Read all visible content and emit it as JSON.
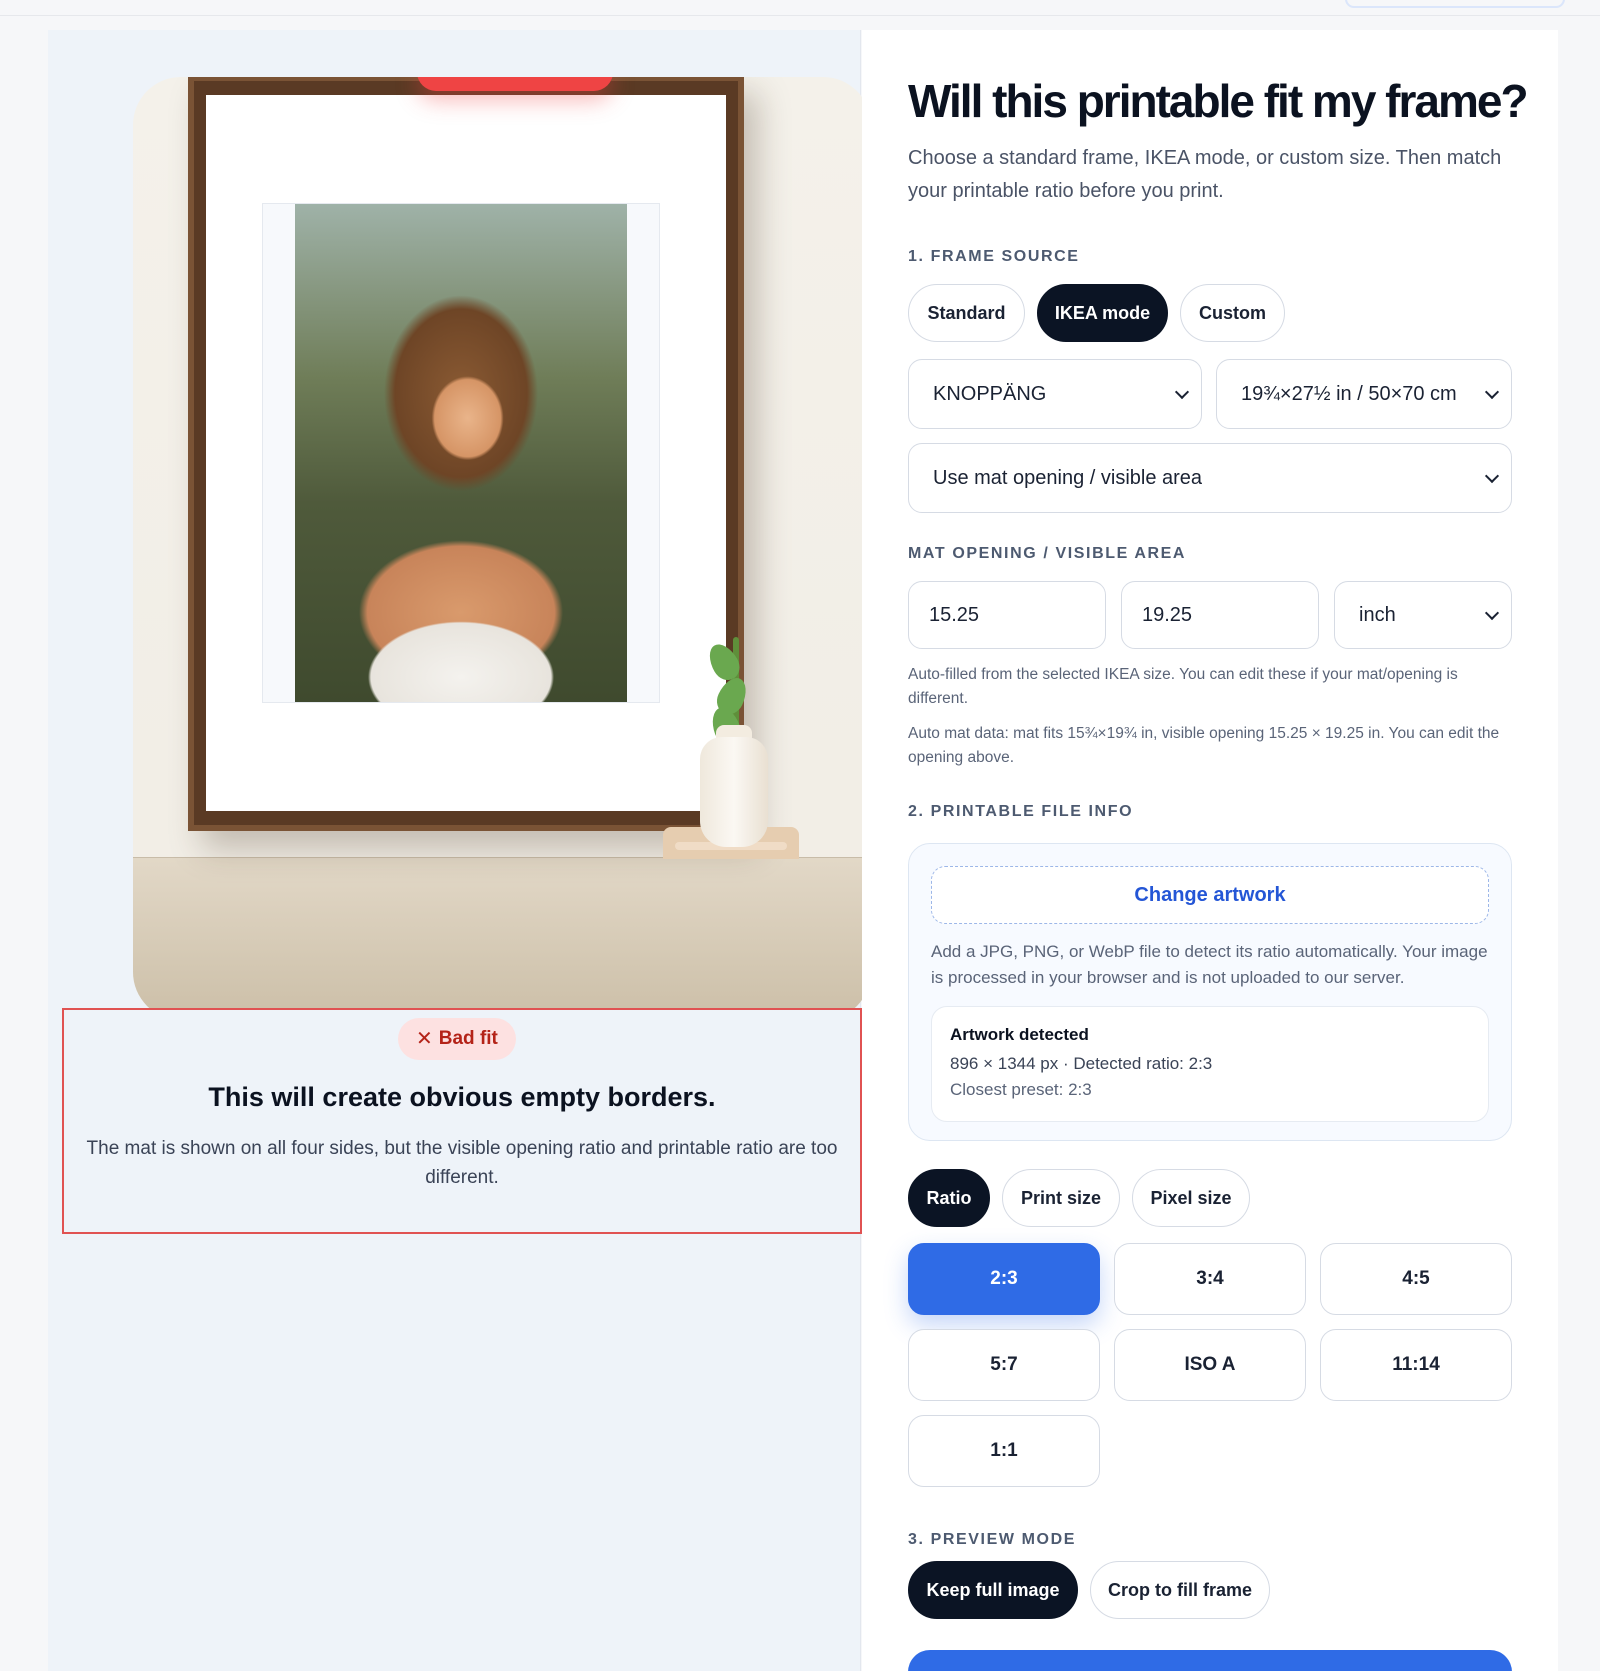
{
  "left": {
    "fit": {
      "badge_icon": "✕",
      "badge": "Bad fit",
      "title": "This will create obvious empty borders.",
      "description": "The mat is shown on all four sides, but the visible opening ratio and printable ratio are too different."
    }
  },
  "right": {
    "title": "Will this printable fit my frame?",
    "subtitle": "Choose a standard frame, IKEA mode, or custom size. Then match your printable ratio before you print.",
    "frame_source": {
      "label": "1. FRAME SOURCE",
      "tabs": [
        {
          "label": "Standard",
          "active": false
        },
        {
          "label": "IKEA mode",
          "active": true
        },
        {
          "label": "Custom",
          "active": false
        }
      ],
      "frame_select": "KNOPPÄNG",
      "size_select": "19¾×27½ in / 50×70 cm",
      "mode_select": "Use mat opening / visible area"
    },
    "mat": {
      "label": "MAT OPENING / VISIBLE AREA",
      "width": "15.25",
      "height": "19.25",
      "unit": "inch",
      "hint1": "Auto-filled from the selected IKEA size. You can edit these if your mat/opening is different.",
      "hint2": "Auto mat data: mat fits 15¾×19¾ in, visible opening 15.25 × 19.25 in. You can edit the opening above."
    },
    "file_info": {
      "label": "2. PRINTABLE FILE INFO",
      "upload_button": "Change artwork",
      "upload_note": "Add a JPG, PNG, or WebP file to detect its ratio automatically. Your image is processed in your browser and is not uploaded to our server.",
      "detected_title": "Artwork detected",
      "detected_dims": "896 × 1344 px · Detected ratio: 2:3",
      "closest_preset": "Closest preset: 2:3"
    },
    "ratio_tabs": [
      {
        "label": "Ratio",
        "active": true
      },
      {
        "label": "Print size",
        "active": false
      },
      {
        "label": "Pixel size",
        "active": false
      }
    ],
    "ratios": [
      "2:3",
      "3:4",
      "4:5",
      "5:7",
      "ISO A",
      "11:14",
      "1:1"
    ],
    "selected_ratio": "2:3",
    "preview": {
      "label": "3. PREVIEW MODE",
      "tabs": [
        {
          "label": "Keep full image",
          "active": true
        },
        {
          "label": "Crop to fill frame",
          "active": false
        }
      ]
    }
  },
  "colors": {
    "accent": "#2f6be6",
    "dark": "#0b1424",
    "bad": "#e05252"
  }
}
